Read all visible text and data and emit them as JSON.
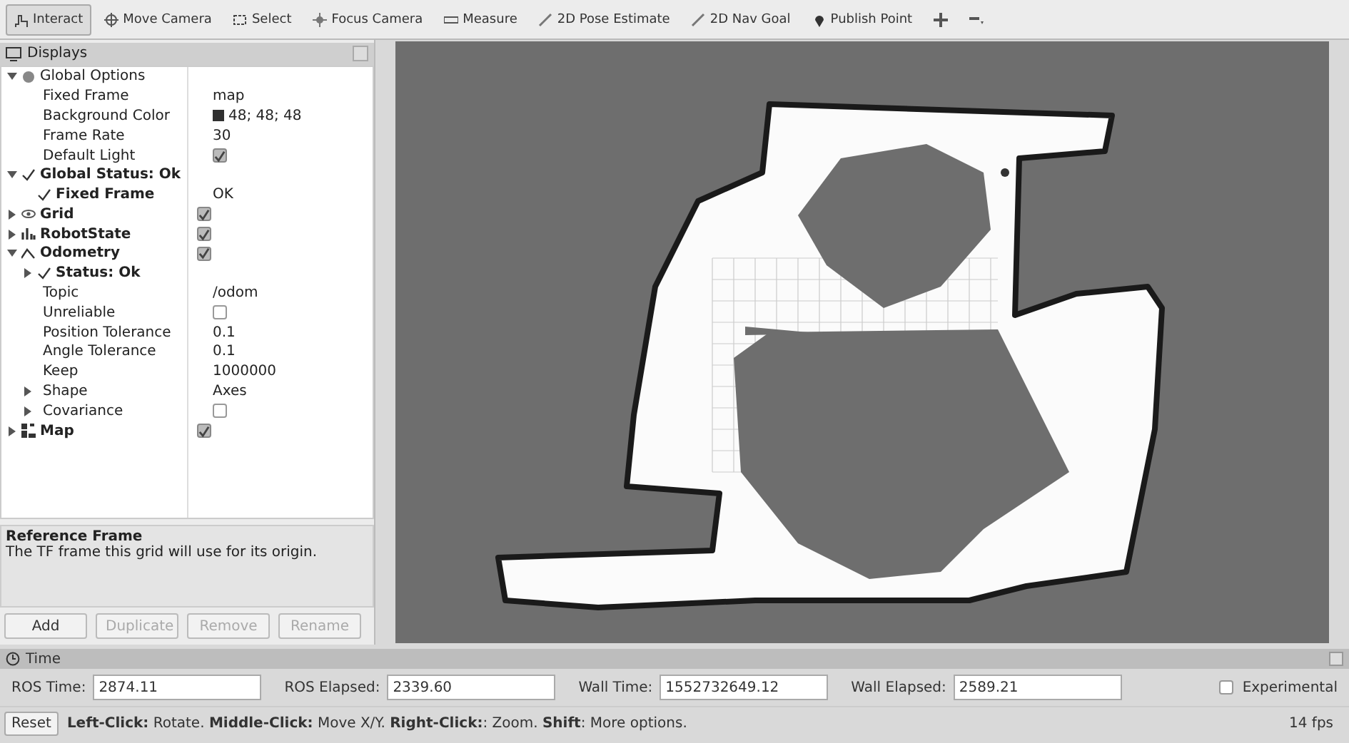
{
  "toolbar": {
    "tools": [
      {
        "kind": "interact",
        "label": "Interact",
        "selected": true
      },
      {
        "kind": "move",
        "label": "Move Camera",
        "selected": false
      },
      {
        "kind": "select",
        "label": "Select",
        "selected": false
      },
      {
        "kind": "focus",
        "label": "Focus Camera",
        "selected": false
      },
      {
        "kind": "measure",
        "label": "Measure",
        "selected": false
      },
      {
        "kind": "pose",
        "label": "2D Pose Estimate",
        "selected": false
      },
      {
        "kind": "goal",
        "label": "2D Nav Goal",
        "selected": false
      },
      {
        "kind": "point",
        "label": "Publish Point",
        "selected": false
      },
      {
        "kind": "crosshair",
        "selected": false
      },
      {
        "kind": "dropdown",
        "selected": false
      }
    ]
  },
  "displays": {
    "title": "Displays",
    "tree": [
      {
        "kind": "options",
        "label": "Global Options",
        "expanded": true,
        "children": [
          {
            "kind": "property",
            "label": "Fixed Frame",
            "value": "map"
          },
          {
            "kind": "property",
            "label": "Background Color",
            "value": "48; 48; 48",
            "color": "#303030"
          },
          {
            "kind": "property",
            "label": "Frame Rate",
            "value": "30"
          },
          {
            "kind": "property",
            "label": "Default Light",
            "checked": true
          }
        ]
      },
      {
        "kind": "status",
        "label": "Global Status: Ok",
        "expanded": true,
        "children": [
          {
            "kind": "status",
            "label": "Fixed Frame",
            "value": "OK"
          }
        ]
      },
      {
        "kind": "grid",
        "label": "Grid",
        "expanded": false,
        "checked": true
      },
      {
        "kind": "robot",
        "label": "RobotState",
        "expanded": false,
        "checked": true
      },
      {
        "kind": "odometry",
        "label": "Odometry",
        "expanded": true,
        "checked": true,
        "children": [
          {
            "kind": "status",
            "label": "Status: Ok",
            "expanded": false
          },
          {
            "kind": "property",
            "label": "Topic",
            "value": "/odom"
          },
          {
            "kind": "property",
            "label": "Unreliable",
            "checked": false
          },
          {
            "kind": "property",
            "label": "Position Tolerance",
            "value": "0.1"
          },
          {
            "kind": "property",
            "label": "Angle Tolerance",
            "value": "0.1"
          },
          {
            "kind": "property",
            "label": "Keep",
            "value": "1000000"
          },
          {
            "kind": "property",
            "label": "Shape",
            "value": "Axes",
            "expanded": false
          },
          {
            "kind": "property",
            "label": "Covariance",
            "checked": false,
            "expanded": false
          }
        ]
      },
      {
        "kind": "map",
        "label": "Map",
        "expanded": false,
        "checked": true
      }
    ],
    "description": {
      "title": "Reference Frame",
      "text": "The TF frame this grid will use for its origin."
    },
    "buttons": [
      {
        "label": "Add",
        "disabled": false
      },
      {
        "label": "Duplicate",
        "disabled": true
      },
      {
        "label": "Remove",
        "disabled": true
      },
      {
        "label": "Rename",
        "disabled": true
      }
    ]
  },
  "time": {
    "title": "Time",
    "fields": [
      {
        "label": "ROS Time:",
        "value": "2874.11"
      },
      {
        "label": "ROS Elapsed:",
        "value": "2339.60"
      },
      {
        "label": "Wall Time:",
        "value": "1552732649.12"
      },
      {
        "label": "Wall Elapsed:",
        "value": "2589.21"
      }
    ],
    "experimental": {
      "label": "Experimental",
      "checked": false
    }
  },
  "status_bar": {
    "button": "Reset",
    "hint": "**Left-Click:** Rotate. **Middle-Click:** Move X/Y. **Right-Click:**: Zoom. **Shift**: More options.",
    "fps": "14 fps"
  }
}
